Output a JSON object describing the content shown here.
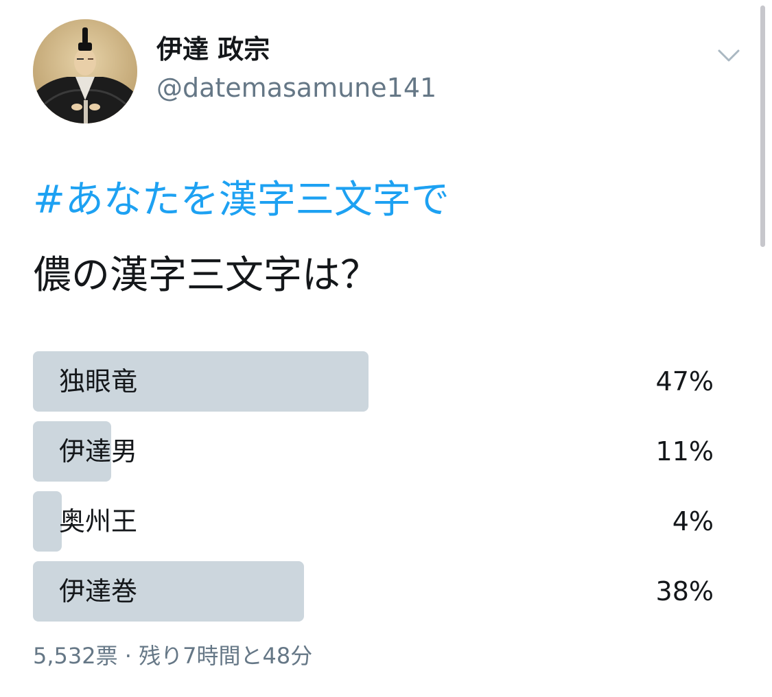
{
  "author": {
    "display_name": "伊達 政宗",
    "handle": "@datemasamune141",
    "avatar_icon": "samurai-portrait-avatar"
  },
  "menu_icon": "chevron-down-icon",
  "tweet": {
    "hashtag": "#あなたを漢字三文字で",
    "question": "儂の漢字三文字は？"
  },
  "poll": {
    "options": [
      {
        "label": "独眼竜",
        "percent_text": "47%",
        "share": 0.47
      },
      {
        "label": "伊達男",
        "percent_text": "11%",
        "share": 0.11
      },
      {
        "label": "奥州王",
        "percent_text": "4%",
        "share": 0.04
      },
      {
        "label": "伊達巻",
        "percent_text": "38%",
        "share": 0.38
      }
    ],
    "summary": "5,532票 · 残り7時間と48分"
  },
  "colors": {
    "link": "#1da1f2",
    "secondary_text": "#657786",
    "poll_bar": "#ccd6dd",
    "primary_text": "#14171a"
  }
}
